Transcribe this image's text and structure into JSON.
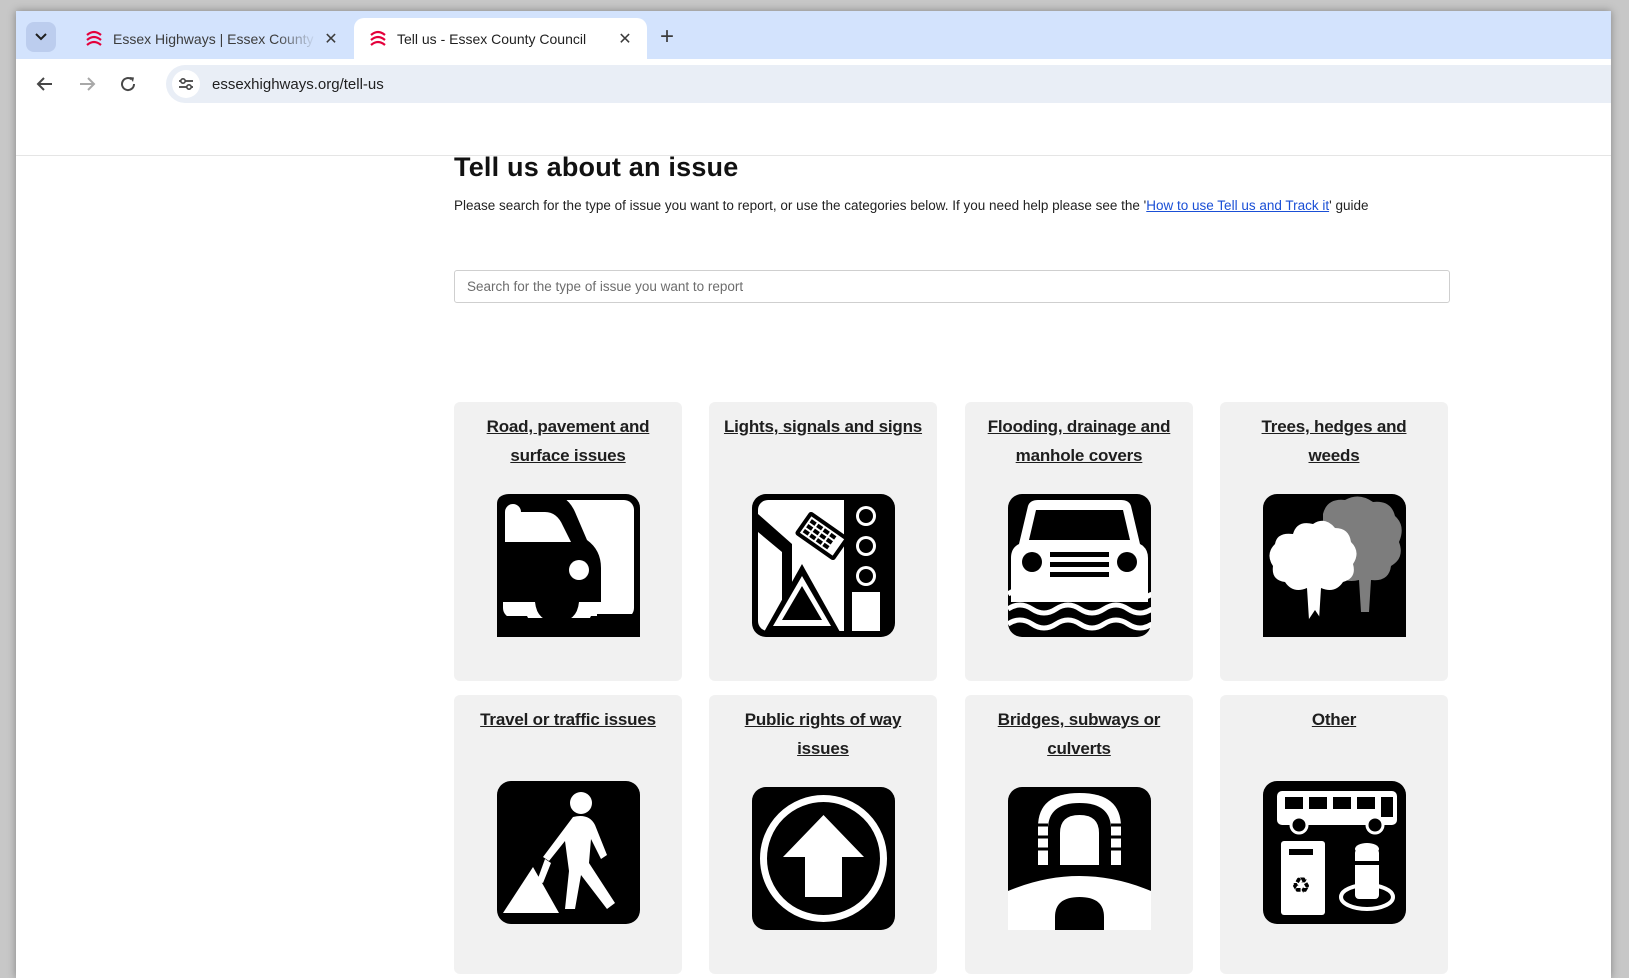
{
  "browser": {
    "tabs": [
      {
        "title": "Essex Highways | Essex County Council",
        "active": false
      },
      {
        "title": "Tell us - Essex County Council",
        "active": true
      }
    ],
    "close_glyph": "✕",
    "new_tab_glyph": "+",
    "url": "essexhighways.org/tell-us"
  },
  "page": {
    "title": "Tell us about an issue",
    "intro_before": "Please search for the type of issue you want to report, or use the categories below. If you need help please see the '",
    "intro_link": "How to use Tell us and Track it",
    "intro_after": "' guide",
    "search_placeholder": "Search for the type of issue you want to report"
  },
  "categories": [
    {
      "label": "Road, pavement and surface issues",
      "icon": "car-pothole-icon"
    },
    {
      "label": "Lights, signals and signs",
      "icon": "traffic-light-sign-icon"
    },
    {
      "label": "Flooding, drainage and manhole covers",
      "icon": "car-flood-icon"
    },
    {
      "label": "Trees, hedges and weeds",
      "icon": "trees-icon"
    },
    {
      "label": "Travel or traffic issues",
      "icon": "roadworks-icon"
    },
    {
      "label": "Public rights of way issues",
      "icon": "arrow-up-circle-icon"
    },
    {
      "label": "Bridges, subways or culverts",
      "icon": "bridge-tunnel-icon"
    },
    {
      "label": "Other",
      "icon": "bus-bin-icon"
    }
  ],
  "colors": {
    "tab_strip": "#d3e3fd",
    "favicon": "#e4003b",
    "link": "#1a4fd6",
    "card_bg": "#f1f1f1"
  }
}
